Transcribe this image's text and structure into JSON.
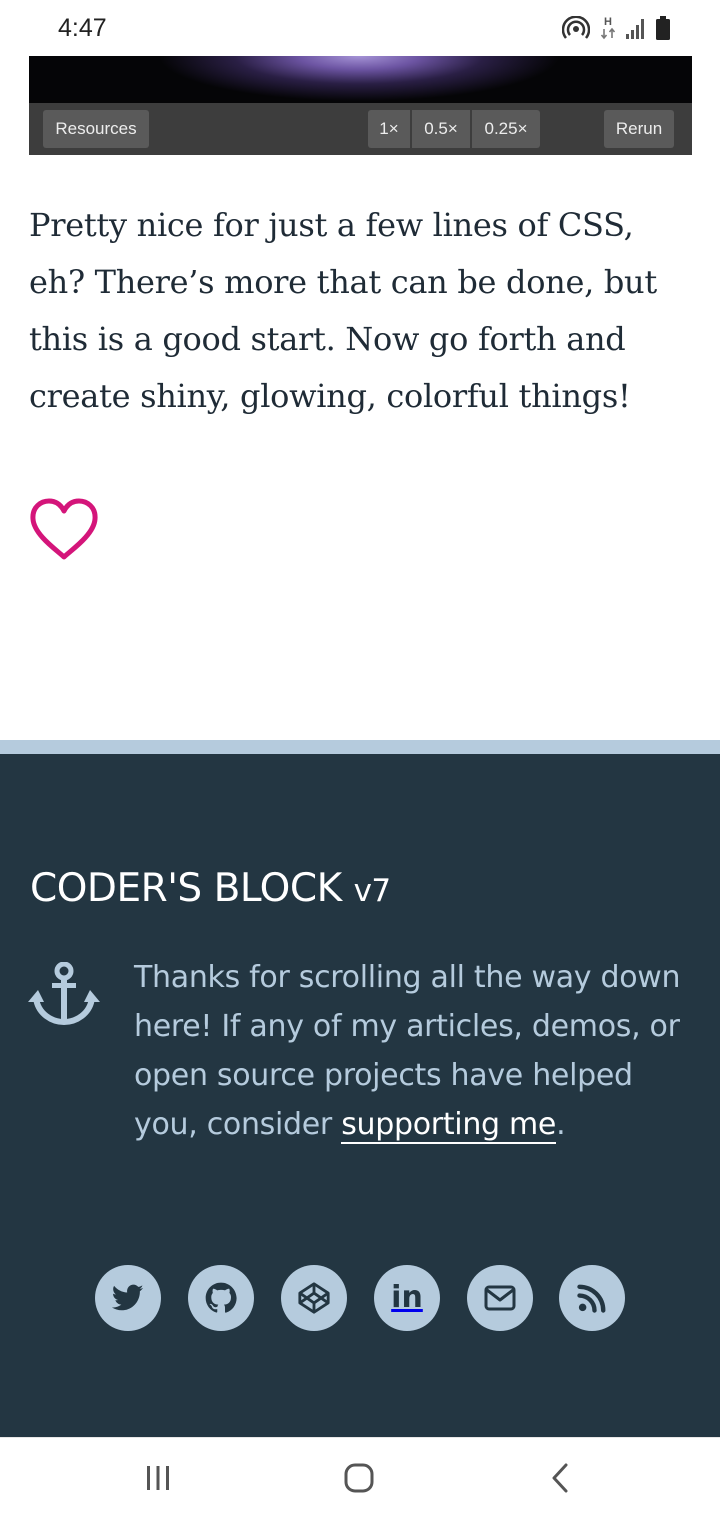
{
  "status_bar": {
    "time": "4:47",
    "icons": [
      "hotspot-icon",
      "data-transfer-icon",
      "signal-icon",
      "battery-icon"
    ]
  },
  "embed": {
    "buttons": {
      "resources": "Resources",
      "speed_1x": "1×",
      "speed_05x": "0.5×",
      "speed_025x": "0.25×",
      "rerun": "Rerun"
    }
  },
  "article": {
    "paragraph": "Pretty nice for just a few lines of CSS, eh? There’s more that can be done, but this is a good start. Now go forth and create shiny, glowing, colorful things!",
    "like_icon": "heart-outline-icon"
  },
  "footer": {
    "title": "CODER'S BLOCK",
    "version": "v7",
    "text_before_link": "Thanks for scrolling all the way down here! If any of my articles, demos, or open source projects have helped you, consider ",
    "link_text": "supporting me",
    "text_after_link": ".",
    "social_links": [
      {
        "icon": "twitter-icon"
      },
      {
        "icon": "github-icon"
      },
      {
        "icon": "codepen-icon"
      },
      {
        "icon": "linkedin-icon",
        "label": "in"
      },
      {
        "icon": "email-icon"
      },
      {
        "icon": "rss-icon"
      }
    ]
  },
  "colors": {
    "accent_heart": "#d4157a",
    "footer_bg": "#233642",
    "footer_text": "#b5cbdd",
    "stripe": "#b5cbdd"
  }
}
